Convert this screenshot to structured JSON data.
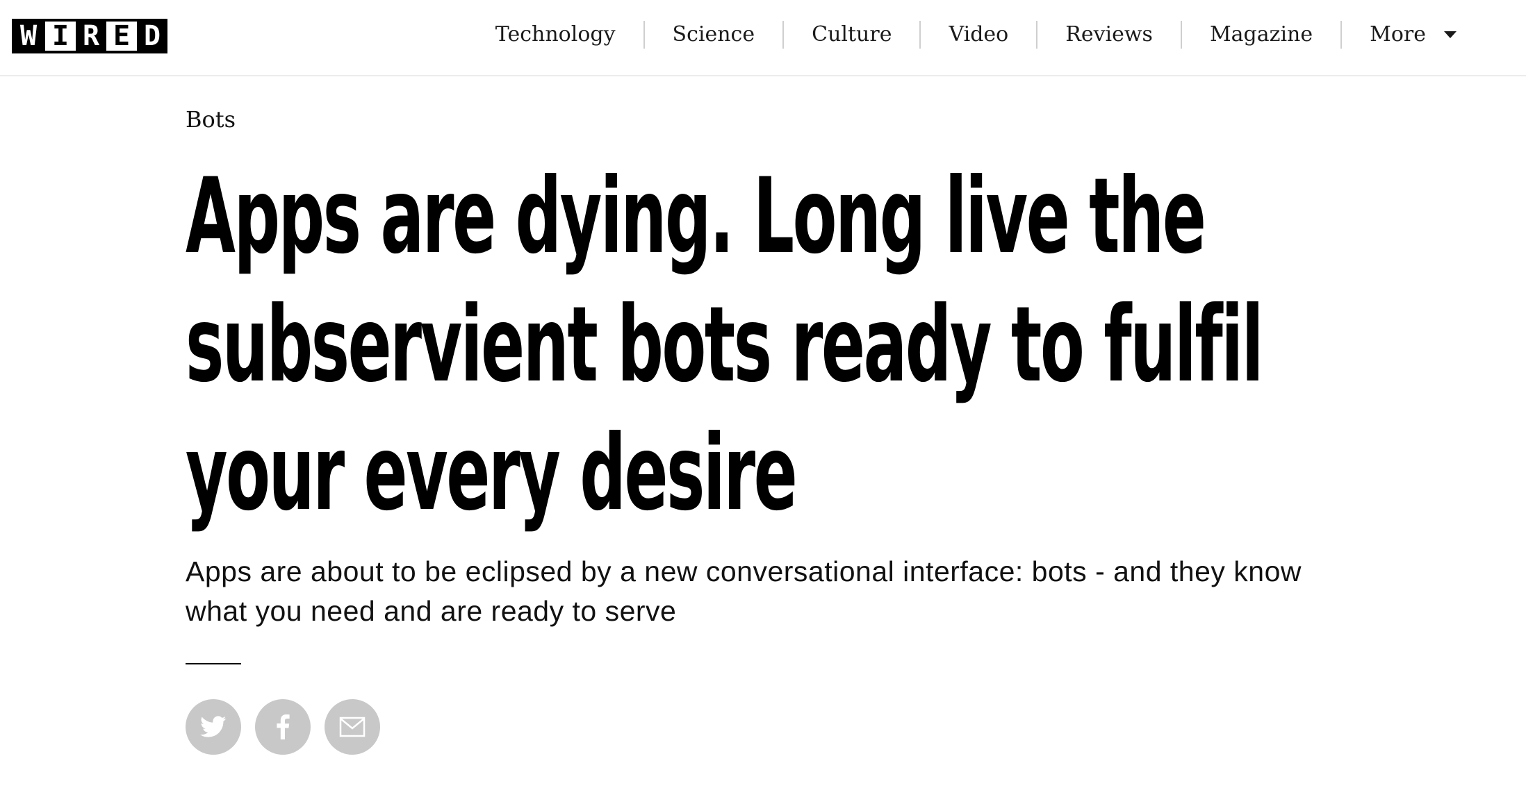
{
  "brand": {
    "logo_letters": [
      "W",
      "I",
      "R",
      "E",
      "D"
    ]
  },
  "nav": {
    "items": [
      {
        "label": "Technology"
      },
      {
        "label": "Science"
      },
      {
        "label": "Culture"
      },
      {
        "label": "Video"
      },
      {
        "label": "Reviews"
      },
      {
        "label": "Magazine"
      },
      {
        "label": "More"
      }
    ]
  },
  "article": {
    "category": "Bots",
    "headline": "Apps are dying. Long live the subservient bots ready to fulfil your every desire",
    "subheadline": "Apps are about to be eclipsed by a new conversational interface: bots - and they know what you need and are ready to serve"
  },
  "share": {
    "buttons": [
      {
        "icon": "twitter-icon"
      },
      {
        "icon": "facebook-icon"
      },
      {
        "icon": "email-icon"
      }
    ]
  },
  "colors": {
    "text": "#000000",
    "share_button_bg": "#c8c8c8",
    "header_border": "#ececec"
  }
}
